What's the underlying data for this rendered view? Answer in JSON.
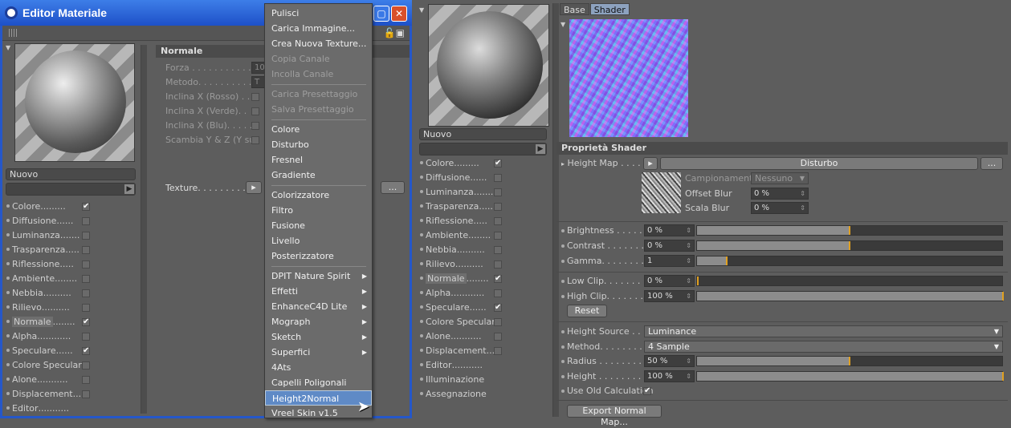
{
  "left_window": {
    "title": "Editor Materiale",
    "preview_name": "Nuovo",
    "channels": [
      {
        "label": "Colore",
        "dots": ".........",
        "checked": true
      },
      {
        "label": "Diffusione",
        "dots": "......",
        "checked": false
      },
      {
        "label": "Luminanza",
        "dots": ".......",
        "checked": false
      },
      {
        "label": "Trasparenza",
        "dots": ".....",
        "checked": false
      },
      {
        "label": "Riflessione",
        "dots": ".....",
        "checked": false
      },
      {
        "label": "Ambiente",
        "dots": "........",
        "checked": false
      },
      {
        "label": "Nebbia",
        "dots": "..........",
        "checked": false
      },
      {
        "label": "Rilievo",
        "dots": "..........",
        "checked": false
      },
      {
        "label": "Normale",
        "dots": "........",
        "checked": true,
        "selected": true
      },
      {
        "label": "Alpha",
        "dots": "............",
        "checked": false
      },
      {
        "label": "Speculare",
        "dots": "......",
        "checked": true
      },
      {
        "label": "Colore Speculare",
        "dots": "",
        "checked": false
      },
      {
        "label": "Alone",
        "dots": "...........",
        "checked": false
      },
      {
        "label": "Displacement",
        "dots": "...",
        "checked": false
      },
      {
        "label": "Editor",
        "dots": "...........",
        "checked": null
      }
    ],
    "section_title": "Normale",
    "params": [
      {
        "label": "Forza . . . . . . . . . . . .",
        "value": "10"
      },
      {
        "label": "Metodo. . . . . . . . . . .",
        "value": "T"
      },
      {
        "label": "Inclina X (Rosso) . .",
        "value": ""
      },
      {
        "label": "Inclina X (Verde). .",
        "value": ""
      },
      {
        "label": "Inclina X (Blu). . . . .",
        "value": ""
      },
      {
        "label": "Scambia Y & Z (Y su)",
        "value": ""
      }
    ],
    "texture_label": "Texture. . . . . . . . . . . .",
    "more_button": "..."
  },
  "context_menu": {
    "items": [
      {
        "label": "Pulisci",
        "disabled": false
      },
      {
        "label": "Carica Immagine...",
        "disabled": false
      },
      {
        "label": "Crea Nuova Texture...",
        "disabled": false
      },
      {
        "label": "Copia Canale",
        "disabled": true
      },
      {
        "label": "Incolla Canale",
        "disabled": true
      },
      {
        "sep": true
      },
      {
        "label": "Carica Presettaggio",
        "disabled": true
      },
      {
        "label": "Salva Presettaggio",
        "disabled": true
      },
      {
        "sep": true
      },
      {
        "label": "Colore"
      },
      {
        "label": "Disturbo"
      },
      {
        "label": "Fresnel"
      },
      {
        "label": "Gradiente"
      },
      {
        "sep": true
      },
      {
        "label": "Colorizzatore"
      },
      {
        "label": "Filtro"
      },
      {
        "label": "Fusione"
      },
      {
        "label": "Livello"
      },
      {
        "label": "Posterizzatore"
      },
      {
        "sep": true
      },
      {
        "label": "DPIT Nature Spirit",
        "submenu": true
      },
      {
        "label": "Effetti",
        "submenu": true
      },
      {
        "label": "EnhanceC4D Lite",
        "submenu": true
      },
      {
        "label": "Mograph",
        "submenu": true
      },
      {
        "label": "Sketch",
        "submenu": true
      },
      {
        "label": "Superfici",
        "submenu": true
      },
      {
        "label": "4Ats"
      },
      {
        "label": "Capelli Poligonali"
      },
      {
        "label": "Height2Normal",
        "highlighted": true
      },
      {
        "label": "Vreel Skin v1.5"
      }
    ]
  },
  "right_panel": {
    "preview_name": "Nuovo",
    "channels": [
      {
        "label": "Colore",
        "dots": ".........",
        "checked": true
      },
      {
        "label": "Diffusione",
        "dots": "......",
        "checked": false
      },
      {
        "label": "Luminanza",
        "dots": ".......",
        "checked": false
      },
      {
        "label": "Trasparenza",
        "dots": ".....",
        "checked": false
      },
      {
        "label": "Riflessione",
        "dots": ".....",
        "checked": false
      },
      {
        "label": "Ambiente",
        "dots": "........",
        "checked": false
      },
      {
        "label": "Nebbia",
        "dots": "..........",
        "checked": false
      },
      {
        "label": "Rilievo",
        "dots": "..........",
        "checked": false
      },
      {
        "label": "Normale",
        "dots": "........",
        "checked": true,
        "selected": true
      },
      {
        "label": "Alpha",
        "dots": "............",
        "checked": false
      },
      {
        "label": "Speculare",
        "dots": "......",
        "checked": true
      },
      {
        "label": "Colore Speculare",
        "dots": "",
        "checked": false
      },
      {
        "label": "Alone",
        "dots": "...........",
        "checked": false
      },
      {
        "label": "Displacement",
        "dots": "...",
        "checked": false
      },
      {
        "label": "Editor",
        "dots": "...........",
        "checked": null
      },
      {
        "label": "Illuminazione",
        "dots": "",
        "checked": null
      },
      {
        "label": "Assegnazione",
        "dots": "",
        "checked": null
      }
    ],
    "tabs": [
      "Base",
      "Shader"
    ],
    "active_tab": "Shader",
    "shader_props_title": "Proprietà Shader",
    "height_map_label": "Height Map . . . . .",
    "height_map_shader": "Disturbo",
    "more_button": "...",
    "campionamento_label": "Campionamento",
    "campionamento_value": "Nessuno",
    "offset_blur_label": "Offset Blur",
    "offset_blur_value": "0 %",
    "scala_blur_label": "Scala Blur",
    "scala_blur_value": "0 %",
    "sliders": [
      {
        "label": "Brightness . . . . . .",
        "value": "0 %",
        "level": 0.5
      },
      {
        "label": "Contrast . . . . . . . .",
        "value": "0 %",
        "level": 0.5
      },
      {
        "label": "Gamma. . . . . . . . . .",
        "value": "1",
        "level": 0.1
      }
    ],
    "clip_sliders": [
      {
        "label": "Low Clip. . . . . . . . .",
        "value": "0 %",
        "level": 0.0
      },
      {
        "label": "High Clip. . . . . . . .",
        "value": "100 %",
        "level": 1.0
      }
    ],
    "reset_button": "Reset",
    "height_source_label": "Height Source . . . .",
    "height_source_value": "Luminance",
    "method_label": "Method. . . . . . . . . .",
    "method_value": "4 Sample",
    "radius_label": "Radius . . . . . . . . . .",
    "radius_value": "50 %",
    "radius_level": 0.5,
    "height_label": "Height . . . . . . . . . .",
    "height_value": "100 %",
    "height_level": 1.0,
    "old_calc_label": "Use Old Calculation",
    "old_calc_checked": true,
    "export_button": "Export Normal Map..."
  }
}
